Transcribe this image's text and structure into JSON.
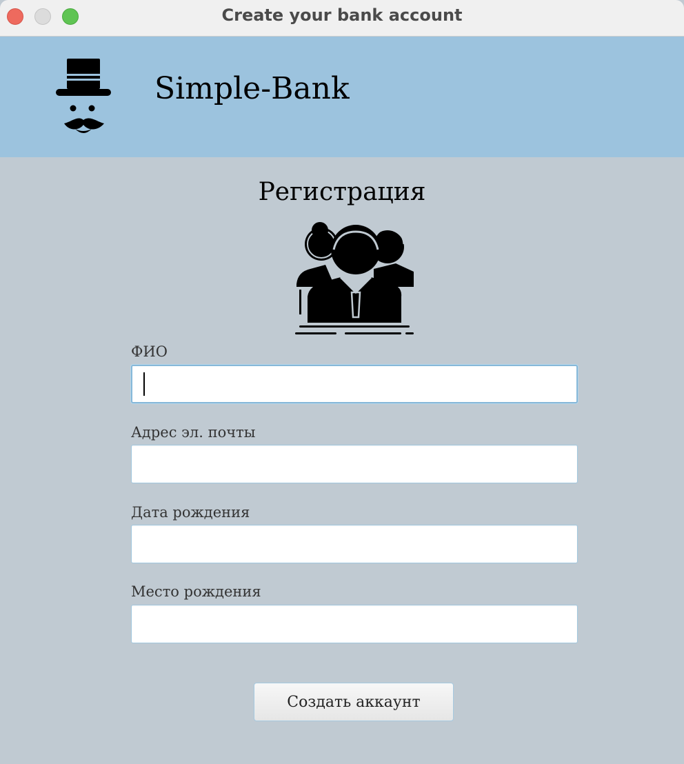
{
  "window": {
    "title": "Create your bank account"
  },
  "header": {
    "brand": "Simple-Bank"
  },
  "form": {
    "title": "Регистрация",
    "fields": [
      {
        "label": "ФИО",
        "value": "",
        "placeholder": ""
      },
      {
        "label": "Адрес эл. почты",
        "value": "",
        "placeholder": ""
      },
      {
        "label": "Дата рождения",
        "value": "",
        "placeholder": ""
      },
      {
        "label": "Место рождения",
        "value": "",
        "placeholder": ""
      }
    ],
    "submit_label": "Создать аккаунт"
  },
  "colors": {
    "titlebar": "#f0f0f0",
    "header": "#9cc3de",
    "background": "#c0cad2",
    "field_border": "#9fc6de"
  },
  "icons": [
    "gentleman-logo-icon",
    "group-users-icon"
  ]
}
